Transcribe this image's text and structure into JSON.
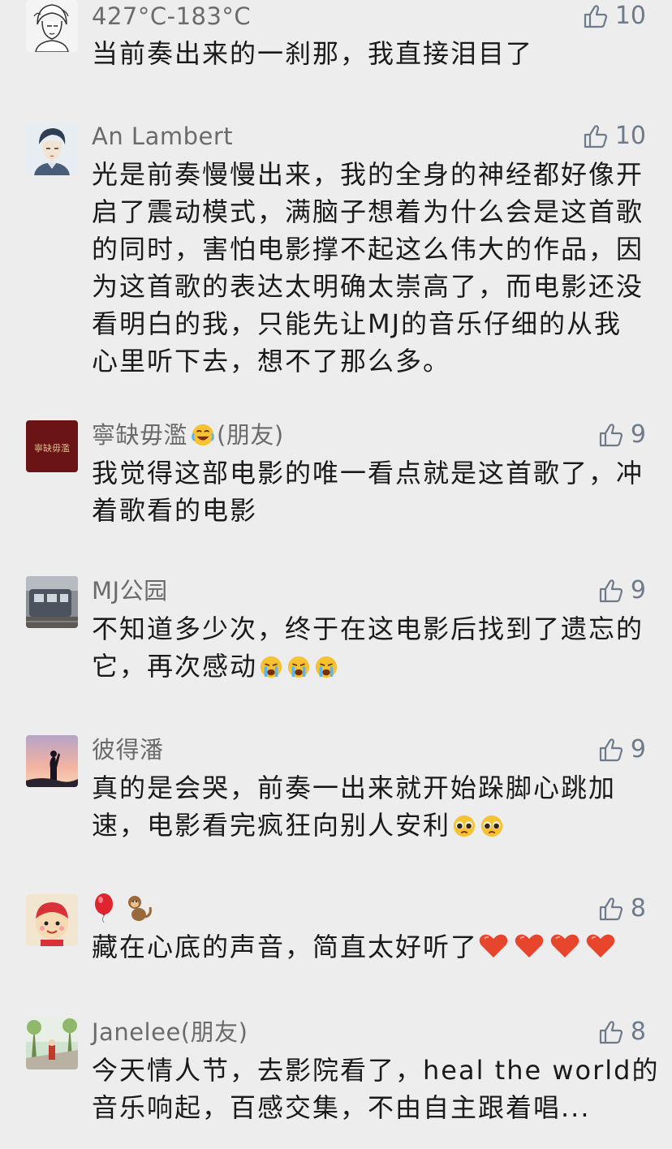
{
  "comments": [
    {
      "name": "427°C-183°C",
      "likes": "10",
      "lines": [
        "当前奏出来的一刹那，我直接泪目了"
      ]
    },
    {
      "name": "An Lambert",
      "likes": "10",
      "lines": [
        "光是前奏慢慢出来，我的全身的神经都好像开",
        "启了震动模式，满脑子想着为什么会是这首歌",
        "的同时，害怕电影撑不起这么伟大的作品，因",
        "为这首歌的表达太明确太崇高了，而电影还没",
        "看明白的我，只能先让MJ的音乐仔细的从我",
        "心里听下去，想不了那么多。"
      ]
    },
    {
      "name": "寧缺毋濫",
      "name_suffix": "(朋友)",
      "name_emoji": "laughing-tears-emoji",
      "likes": "9",
      "avatar_text": "寧缺毋濫",
      "lines": [
        "我觉得这部电影的唯一看点就是这首歌了，冲",
        "着歌看的电影"
      ]
    },
    {
      "name": "MJ公园",
      "likes": "9",
      "lines": [
        "不知道多少次，终于在这电影后找到了遗忘的",
        "它，再次感动"
      ],
      "trailing_emojis": [
        "crying-face-emoji",
        "crying-face-emoji",
        "crying-face-emoji"
      ]
    },
    {
      "name": "彼得潘",
      "likes": "9",
      "lines": [
        "真的是会哭，前奏一出来就开始跺脚心跳加",
        "速，电影看完疯狂向别人安利"
      ],
      "trailing_emojis": [
        "pleading-face-emoji",
        "pleading-face-emoji"
      ]
    },
    {
      "name_emojis": [
        "balloon-emoji",
        "monkey-emoji"
      ],
      "likes": "8",
      "lines": [
        "藏在心底的声音，简直太好听了"
      ],
      "trailing_emojis": [
        "heart-emoji",
        "heart-emoji",
        "heart-emoji",
        "heart-emoji"
      ]
    },
    {
      "name": "Janelee(朋友)",
      "likes": "8",
      "lines": [
        "今天情人节，去影院看了，heal the world的",
        "音乐响起，百感交集，不由自主跟着唱..."
      ]
    }
  ],
  "colors": {
    "background": "#ededed",
    "name_text": "#6b6b6b",
    "body_text": "#1a1a1a",
    "like_icon": "#6f7b8a",
    "heart": "#e8452d",
    "emoji_face": "#f6c232"
  }
}
